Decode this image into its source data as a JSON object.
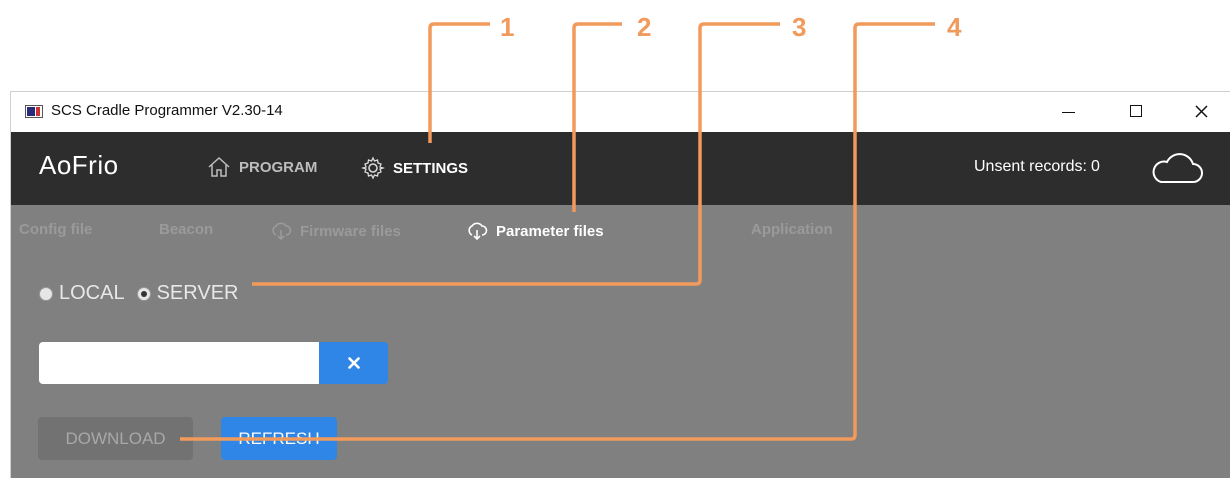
{
  "window": {
    "title": "SCS Cradle Programmer V2.30-14",
    "controls": {
      "minimize": "minimize-icon",
      "maximize": "maximize-icon",
      "close": "close-icon"
    }
  },
  "navbar": {
    "logo": "AoFrio",
    "items": [
      {
        "label": "PROGRAM",
        "icon": "home-icon"
      },
      {
        "label": "SETTINGS",
        "icon": "gear-icon"
      }
    ],
    "unsent_label": "Unsent records:",
    "unsent_count": "0",
    "cloud_icon": "cloud-icon"
  },
  "subtabs": [
    {
      "label": "Config file",
      "active": false
    },
    {
      "label": "Beacon",
      "active": false
    },
    {
      "label": "Firmware files",
      "icon": "cloud-download-icon",
      "active": false
    },
    {
      "label": "Parameter files",
      "icon": "cloud-download-icon",
      "active": true
    },
    {
      "label": "Application",
      "active": false
    }
  ],
  "source": {
    "options": [
      {
        "label": "LOCAL",
        "checked": false
      },
      {
        "label": "SERVER",
        "checked": true
      }
    ]
  },
  "search": {
    "value": "",
    "clear_icon": "times-icon"
  },
  "actions": {
    "download_label": "DOWNLOAD",
    "refresh_label": "REFRESH"
  },
  "callouts": [
    "1",
    "2",
    "3",
    "4"
  ],
  "colors": {
    "accent": "#2f86e6",
    "navbar": "#2d2d2d",
    "panel": "#808080",
    "callout": "#f29a5c"
  }
}
